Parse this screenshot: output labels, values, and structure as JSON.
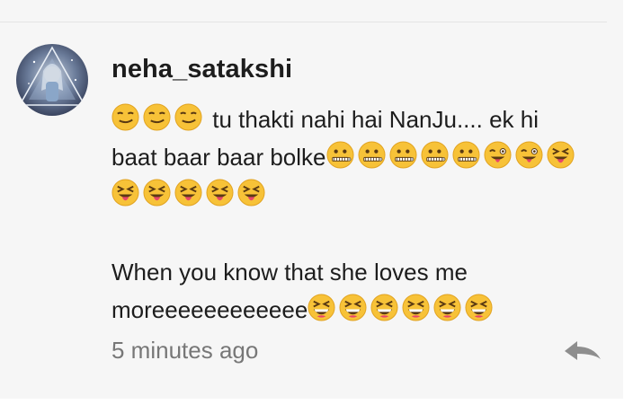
{
  "comment": {
    "username": "neha_satakshi",
    "lines": [
      {
        "pre": [
          "smirk",
          "smirk",
          "smirk"
        ],
        "text": " tu thakti nahi hai NanJu.... ek hi",
        "post": []
      },
      {
        "pre": [],
        "text": "baat baar baar bolke",
        "post": [
          "zipper",
          "zipper",
          "zipper",
          "zipper",
          "zipper",
          "wink-tongue",
          "wink-tongue",
          "squint-tongue"
        ]
      },
      {
        "pre": [
          "squint-tongue",
          "squint-tongue",
          "squint-tongue",
          "squint-tongue",
          "squint-tongue"
        ],
        "text": "",
        "post": []
      },
      {
        "pre": [],
        "text": "",
        "post": []
      },
      {
        "pre": [],
        "text": "When you know that she loves me",
        "post": []
      },
      {
        "pre": [],
        "text": "moreeeeeeeeeeee",
        "post": [
          "laughing",
          "laughing",
          "laughing",
          "laughing",
          "laughing",
          "laughing"
        ]
      }
    ],
    "timestamp": "5 minutes ago",
    "reply_icon": "reply-icon"
  },
  "colors": {
    "background": "#f6f6f6",
    "text": "#1d1d1d",
    "muted": "#777777",
    "emoji_yellow": "#f7c238"
  }
}
